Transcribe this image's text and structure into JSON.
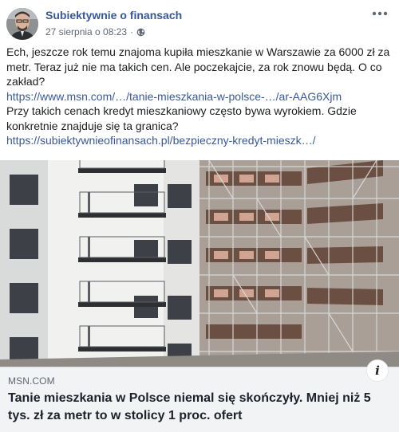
{
  "post": {
    "page_name": "Subiektywnie o finansach",
    "timestamp": "27 sierpnia o 08:23",
    "separator": "·",
    "privacy_icon": "globe-icon",
    "more_icon": "more-options-icon"
  },
  "text": {
    "line1": "Ech, jeszcze rok temu znajoma kupiła mieszkanie w Warszawie za 6000 zł za metr. Teraz już nie ma takich cen. Ale poczekajcie, za rok znowu będą. O co zakład?",
    "link1": "https://www.msn.com/…/tanie-mieszkania-w-polsce-…/ar-AAG6Xjm",
    "line2": "Przy takich cenach kredyt mieszkaniowy często bywa wyrokiem. Gdzie konkretnie znajduje się ta granica?",
    "link2": "https://subiektywnieofinansach.pl/bezpieczny-kredyt-mieszk…/"
  },
  "link_preview": {
    "domain": "MSN.COM",
    "title": "Tanie mieszkania w Polsce niemal się skończyły. Mniej niż 5 tys. zł za metr to w stolicy 1 proc. ofert",
    "info_label": "i"
  },
  "colors": {
    "page_name": "#385898",
    "link": "#385898",
    "meta": "#616770",
    "preview_bg": "#f2f3f5"
  }
}
